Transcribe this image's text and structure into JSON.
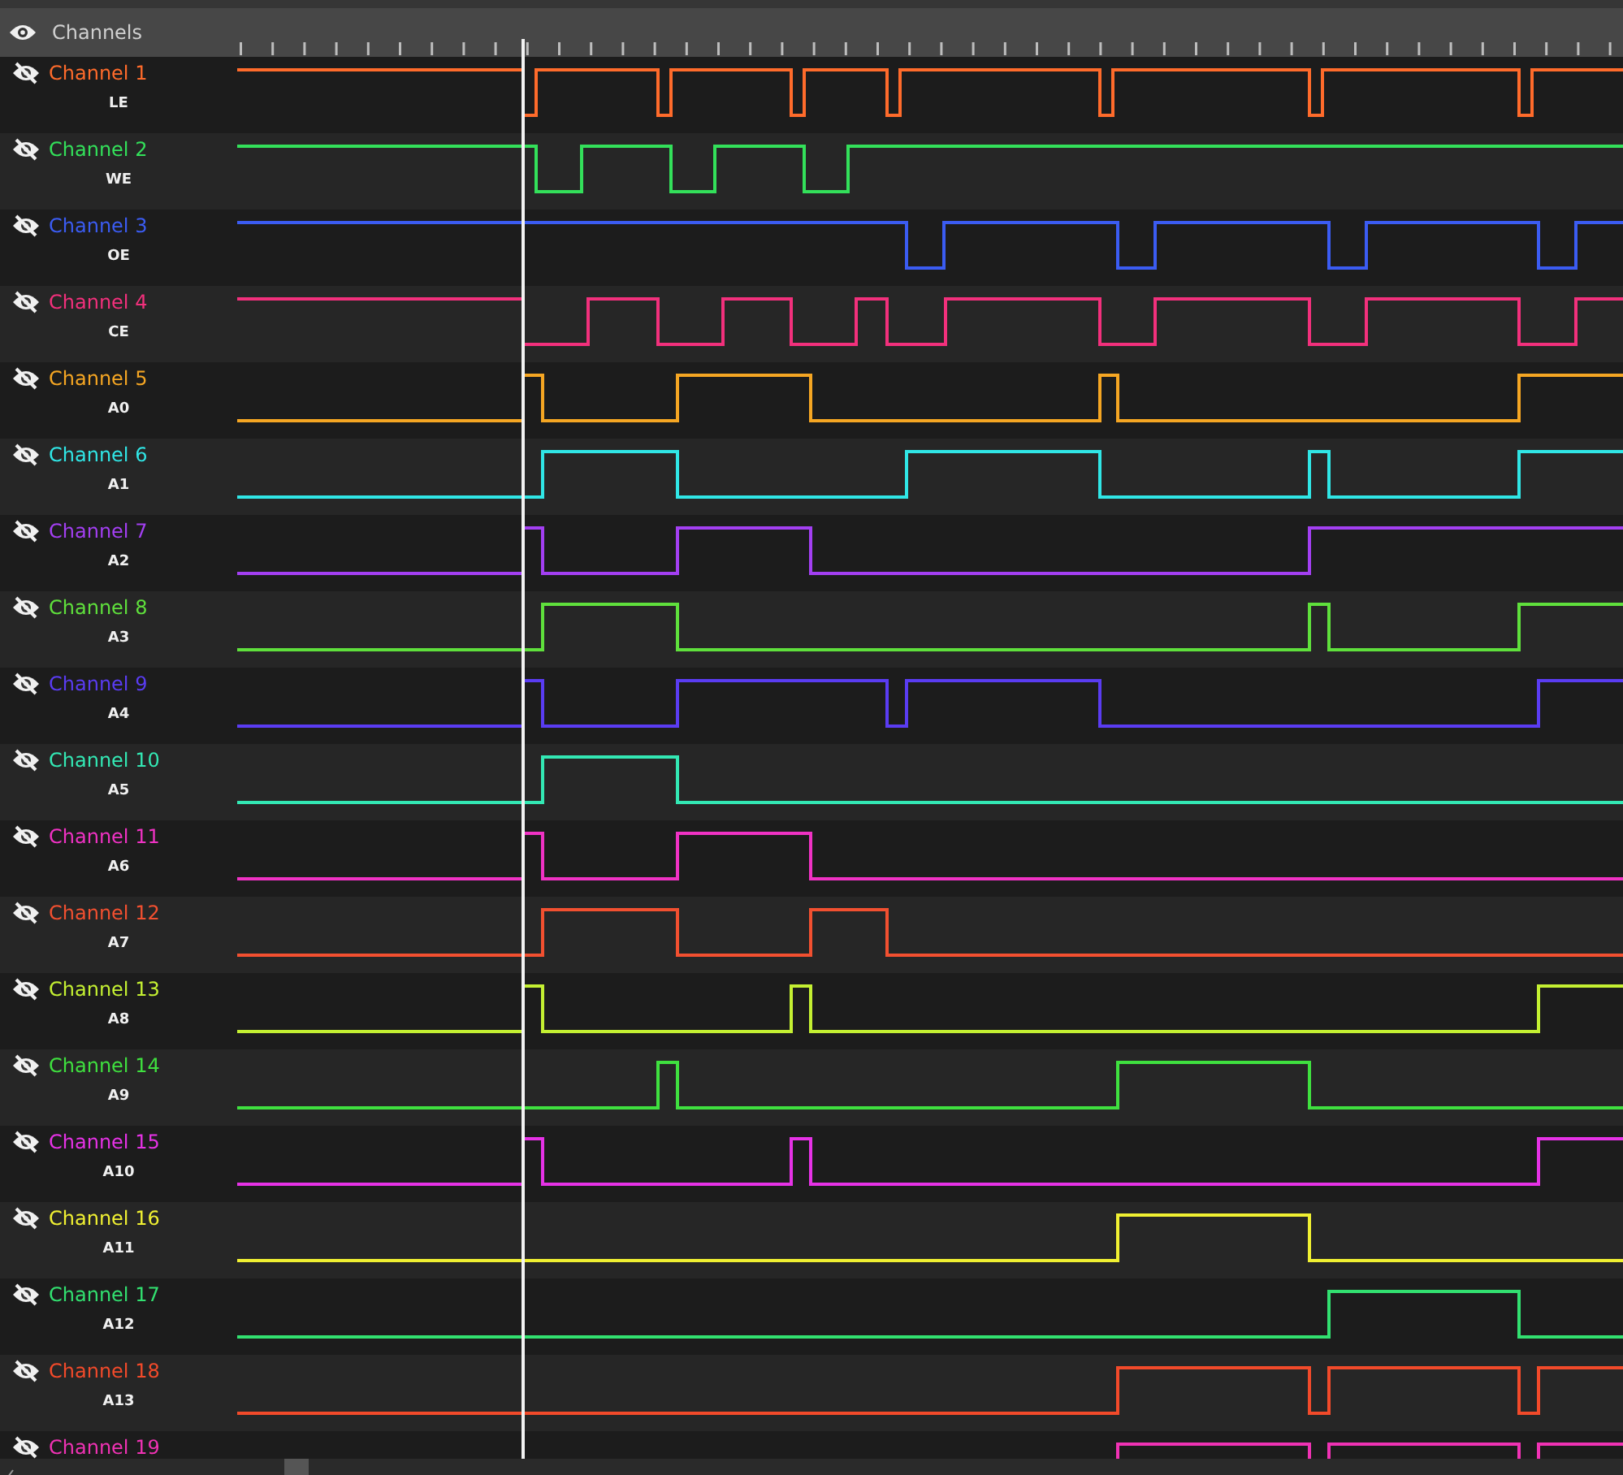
{
  "panel": {
    "title": "Channels"
  },
  "channels": [
    {
      "name": "Channel 1",
      "signal": "LE",
      "color": "#ff6b2b"
    },
    {
      "name": "Channel 2",
      "signal": "WE",
      "color": "#33e05a"
    },
    {
      "name": "Channel 3",
      "signal": "OE",
      "color": "#3b5cf2"
    },
    {
      "name": "Channel 4",
      "signal": "CE",
      "color": "#f2307c"
    },
    {
      "name": "Channel 5",
      "signal": "A0",
      "color": "#f5a623"
    },
    {
      "name": "Channel 6",
      "signal": "A1",
      "color": "#30e6e6"
    },
    {
      "name": "Channel 7",
      "signal": "A2",
      "color": "#a33ff2"
    },
    {
      "name": "Channel 8",
      "signal": "A3",
      "color": "#5fe03c"
    },
    {
      "name": "Channel 9",
      "signal": "A4",
      "color": "#5a3cf2"
    },
    {
      "name": "Channel 10",
      "signal": "A5",
      "color": "#33e8b4"
    },
    {
      "name": "Channel 11",
      "signal": "A6",
      "color": "#f032c4"
    },
    {
      "name": "Channel 12",
      "signal": "A7",
      "color": "#f25030"
    },
    {
      "name": "Channel 13",
      "signal": "A8",
      "color": "#c4f032"
    },
    {
      "name": "Channel 14",
      "signal": "A9",
      "color": "#3fe03f"
    },
    {
      "name": "Channel 15",
      "signal": "A10",
      "color": "#e632e6"
    },
    {
      "name": "Channel 16",
      "signal": "A11",
      "color": "#f0f032"
    },
    {
      "name": "Channel 17",
      "signal": "A12",
      "color": "#32e070"
    },
    {
      "name": "Channel 18",
      "signal": "A13",
      "color": "#f24a2a"
    },
    {
      "name": "Channel 19",
      "color": "#f032b4"
    }
  ]
}
